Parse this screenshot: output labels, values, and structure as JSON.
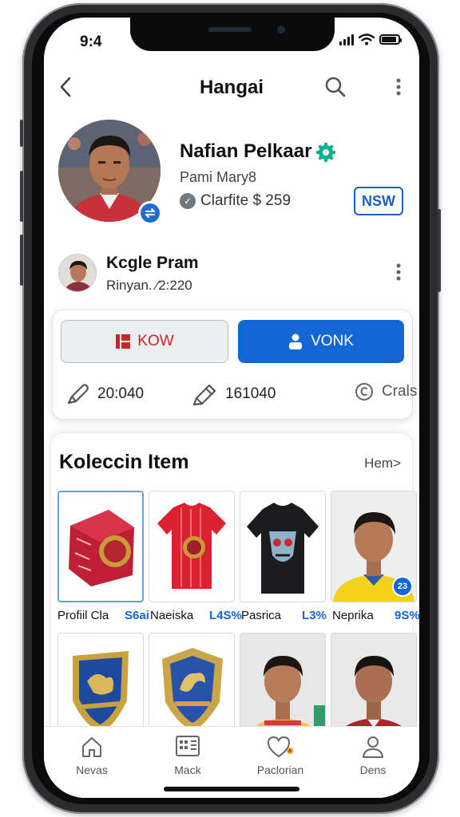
{
  "status_bar": {
    "time": "9:4"
  },
  "header": {
    "title": "Hangai"
  },
  "profile": {
    "name": "Nafian Pelkaar",
    "handle": "Pami Mary8",
    "balance": "Clarfite $ 259",
    "new_badge": "NSW"
  },
  "sub_profile": {
    "name": "Kcgle Pram",
    "meta": "Rinyan. ⁄2:220"
  },
  "actions": {
    "view_label": "KOW",
    "vonk_label": "VONK"
  },
  "stats": [
    {
      "icon": "pen-icon",
      "value": "20:040"
    },
    {
      "icon": "pencil-icon",
      "value": "161040"
    },
    {
      "icon": "coin-icon",
      "value": "Crals"
    }
  ],
  "collection": {
    "title": "Koleccin Item",
    "link": "Hem>",
    "items": [
      {
        "label": "Profiil Cla",
        "value": "S6ai"
      },
      {
        "label": "Naeiska",
        "value": "L4S%"
      },
      {
        "label": "Pasrica",
        "value": "L3%"
      },
      {
        "label": "Neprika",
        "value": "9S%",
        "badge": "23"
      }
    ]
  },
  "tabbar": {
    "tabs": [
      {
        "label": "Nevas",
        "icon": "home-icon"
      },
      {
        "label": "Mack",
        "icon": "grid-icon"
      },
      {
        "label": "Paclorian",
        "icon": "heart-icon"
      },
      {
        "label": "Dens",
        "icon": "person-icon"
      }
    ]
  },
  "colors": {
    "accent": "#1266d6",
    "verified": "#0bb08a",
    "danger": "#c6262e"
  }
}
